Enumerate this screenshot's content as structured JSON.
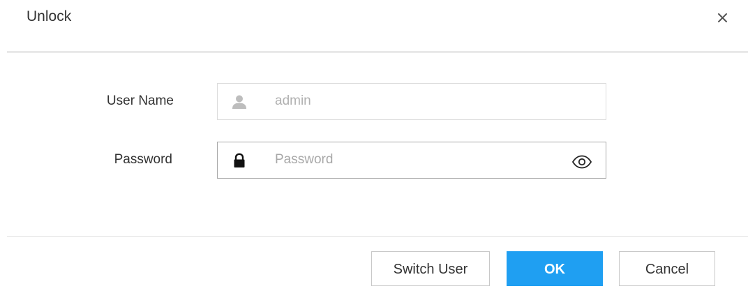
{
  "dialog": {
    "title": "Unlock",
    "close_icon": "close-icon"
  },
  "form": {
    "username": {
      "label": "User Name",
      "icon": "user-icon",
      "value": "admin"
    },
    "password": {
      "label": "Password",
      "icon": "lock-icon",
      "value": "",
      "placeholder": "Password",
      "toggle_icon": "eye-icon"
    }
  },
  "buttons": {
    "switch_user": "Switch User",
    "ok": "OK",
    "cancel": "Cancel"
  },
  "colors": {
    "primary": "#1f9ff2",
    "text": "#333333",
    "muted_text": "#b0b0b0",
    "border": "#dcdcdc"
  }
}
